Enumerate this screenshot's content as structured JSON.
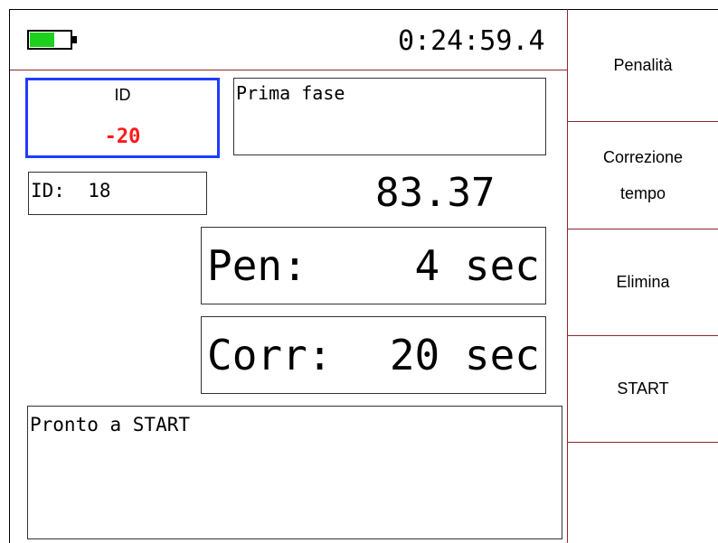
{
  "status": {
    "battery_level": 0.62,
    "battery_color": "#1ed11e",
    "clock": "0:24:59.4"
  },
  "id_panel": {
    "label": "ID",
    "value": "-20",
    "value_color": "#ff1a1a",
    "border_color": "#1e3cff"
  },
  "phase": {
    "text": "Prima fase"
  },
  "id_small": {
    "text": "ID:  18"
  },
  "time": {
    "value": "83.37"
  },
  "penalty": {
    "label": "Pen:",
    "value": "4 sec"
  },
  "correction": {
    "label": "Corr:",
    "value": "20 sec"
  },
  "message": {
    "text": "Pronto a START"
  },
  "sidebar": {
    "buttons": [
      {
        "label": "Penalità"
      },
      {
        "label_line1": "Correzione",
        "label_line2": "tempo"
      },
      {
        "label": "Elimina"
      },
      {
        "label": "START"
      }
    ]
  },
  "colors": {
    "divider": "#8b2a2a"
  }
}
